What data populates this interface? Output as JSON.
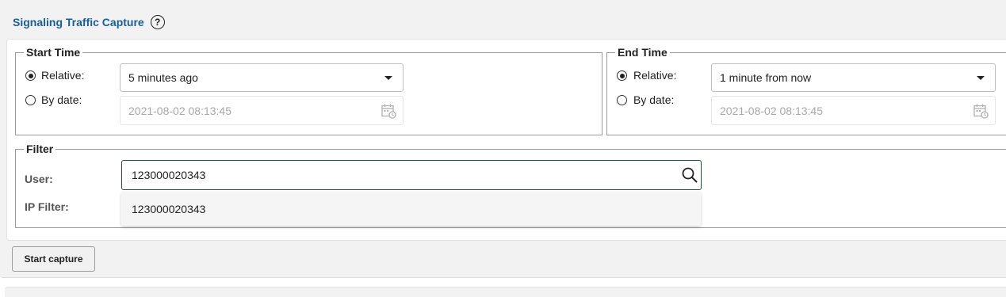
{
  "header": {
    "title": "Signaling Traffic Capture",
    "help_icon": "help-circle-icon",
    "help_glyph": "?"
  },
  "start_time": {
    "legend": "Start Time",
    "relative_label": "Relative:",
    "by_date_label": "By date:",
    "selected_mode": "relative",
    "relative_value": "5 minutes ago",
    "date_value": "2021-08-02 08:13:45"
  },
  "end_time": {
    "legend": "End Time",
    "relative_label": "Relative:",
    "by_date_label": "By date:",
    "selected_mode": "relative",
    "relative_value": "1 minute from now",
    "date_value": "2021-08-02 08:13:45"
  },
  "filter": {
    "legend": "Filter",
    "user_label": "User:",
    "user_value": "123000020343",
    "ip_filter_label": "IP Filter:",
    "suggestions": [
      "123000020343"
    ]
  },
  "actions": {
    "start_capture": "Start capture"
  },
  "colors": {
    "title": "#1a5d9b",
    "panel_bg": "#f2f2f2",
    "border": "#9a9a9a",
    "disabled_text": "#a8a8a8"
  }
}
